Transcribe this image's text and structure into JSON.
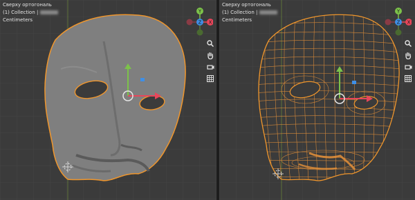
{
  "left_viewport": {
    "view_name": "Сверху ортогональ",
    "collection": "(1) Collection |",
    "units": "Centimeters",
    "display_mode": "solid"
  },
  "right_viewport": {
    "view_name": "Сверху ортогональ",
    "collection": "(1) Collection |",
    "units": "Centimeters",
    "display_mode": "wireframe"
  },
  "gizmo": {
    "axis_y": "Y",
    "axis_x": "X",
    "axis_z": "Z",
    "colors": {
      "x": "#e8465a",
      "y": "#7cc24a",
      "z": "#3f8fe6",
      "neg_x": "#8a3b45"
    }
  },
  "navigation_tools": [
    "zoom-icon",
    "hand-icon",
    "camera-icon",
    "grid-icon"
  ],
  "colors": {
    "background": "#3b3b3b",
    "grid": "#4a4a4a",
    "mesh_solid": "#7f7f7f",
    "selection_outline": "#f0962c",
    "wireframe": "#e5913a"
  }
}
